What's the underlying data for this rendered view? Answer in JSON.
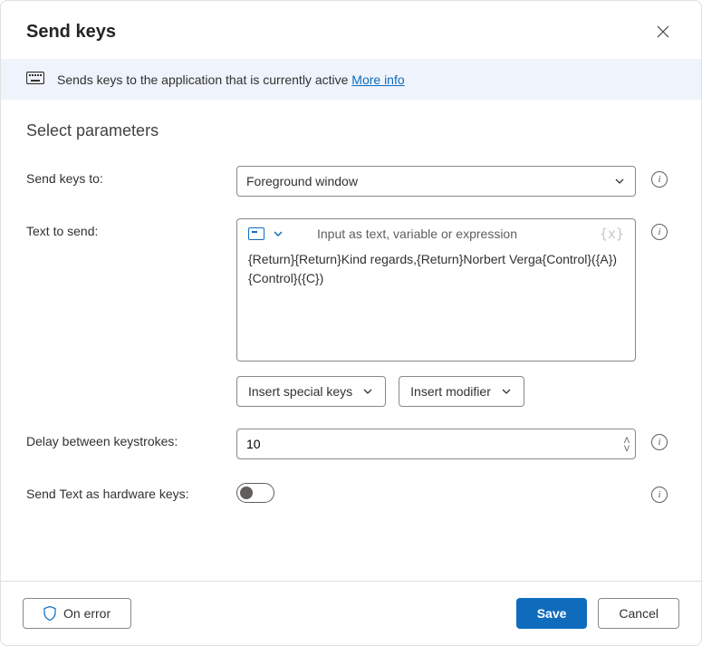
{
  "dialog": {
    "title": "Send keys"
  },
  "banner": {
    "text": "Sends keys to the application that is currently active ",
    "link": "More info"
  },
  "section": {
    "title": "Select parameters"
  },
  "fields": {
    "sendKeysTo": {
      "label": "Send keys to:",
      "value": "Foreground window"
    },
    "textToSend": {
      "label": "Text to send:",
      "hint": "Input as text, variable or expression",
      "value": "{Return}{Return}Kind regards,{Return}Norbert Verga{Control}({A}){Control}({C})"
    },
    "insertSpecialKeys": "Insert special keys",
    "insertModifier": "Insert modifier",
    "delay": {
      "label": "Delay between keystrokes:",
      "value": "10"
    },
    "hardware": {
      "label": "Send Text as hardware keys:"
    }
  },
  "footer": {
    "onError": "On error",
    "save": "Save",
    "cancel": "Cancel"
  }
}
